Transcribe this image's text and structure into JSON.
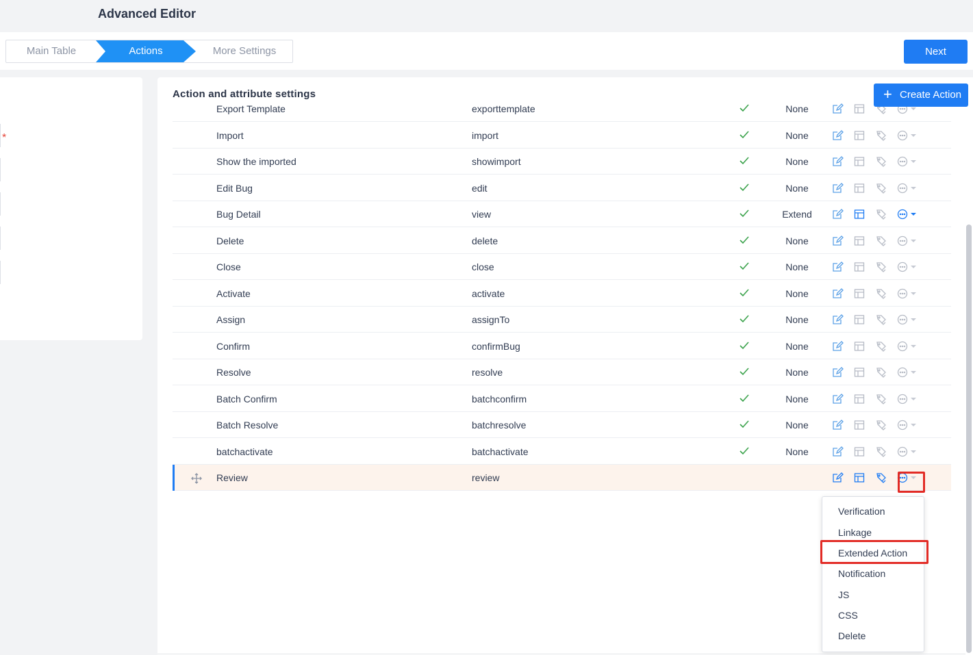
{
  "page": {
    "title": "Advanced Editor"
  },
  "steps": [
    {
      "label": "Main Table",
      "active": false
    },
    {
      "label": "Actions",
      "active": true
    },
    {
      "label": "More Settings",
      "active": false
    }
  ],
  "next_label": "Next",
  "panel": {
    "title": "Action and attribute settings",
    "create_label": "Create Action",
    "create_icon": "plus-icon"
  },
  "colors": {
    "primary": "#1f7cf3",
    "step_active": "#1f91f5",
    "highlight_box": "#e22b25",
    "check": "#3aa24b",
    "icon_default": "#5aa0e6",
    "icon_muted": "#b6bbc5"
  },
  "rows": [
    {
      "name": "Export Template",
      "code": "exporttemplate",
      "enabled": true,
      "extend": "None",
      "state": "default"
    },
    {
      "name": "Import",
      "code": "import",
      "enabled": true,
      "extend": "None",
      "state": "default"
    },
    {
      "name": "Show the imported",
      "code": "showimport",
      "enabled": true,
      "extend": "None",
      "state": "default"
    },
    {
      "name": "Edit Bug",
      "code": "edit",
      "enabled": true,
      "extend": "None",
      "state": "default"
    },
    {
      "name": "Bug Detail",
      "code": "view",
      "enabled": true,
      "extend": "Extend",
      "state": "active"
    },
    {
      "name": "Delete",
      "code": "delete",
      "enabled": true,
      "extend": "None",
      "state": "default"
    },
    {
      "name": "Close",
      "code": "close",
      "enabled": true,
      "extend": "None",
      "state": "default"
    },
    {
      "name": "Activate",
      "code": "activate",
      "enabled": true,
      "extend": "None",
      "state": "default"
    },
    {
      "name": "Assign",
      "code": "assignTo",
      "enabled": true,
      "extend": "None",
      "state": "default"
    },
    {
      "name": "Confirm",
      "code": "confirmBug",
      "enabled": true,
      "extend": "None",
      "state": "default"
    },
    {
      "name": "Resolve",
      "code": "resolve",
      "enabled": true,
      "extend": "None",
      "state": "default"
    },
    {
      "name": "Batch Confirm",
      "code": "batchconfirm",
      "enabled": true,
      "extend": "None",
      "state": "default"
    },
    {
      "name": "Batch Resolve",
      "code": "batchresolve",
      "enabled": true,
      "extend": "None",
      "state": "default"
    },
    {
      "name": "batchactivate",
      "code": "batchactivate",
      "enabled": true,
      "extend": "None",
      "state": "default"
    },
    {
      "name": "Review",
      "code": "review",
      "enabled": false,
      "extend": "",
      "state": "highlight"
    }
  ],
  "row_icons": [
    "edit-icon",
    "layout-icon",
    "tag-icon",
    "more-icon"
  ],
  "dropdown": {
    "items": [
      "Verification",
      "Linkage",
      "Extended Action",
      "Notification",
      "JS",
      "CSS",
      "Delete"
    ],
    "highlighted": "Extended Action"
  }
}
